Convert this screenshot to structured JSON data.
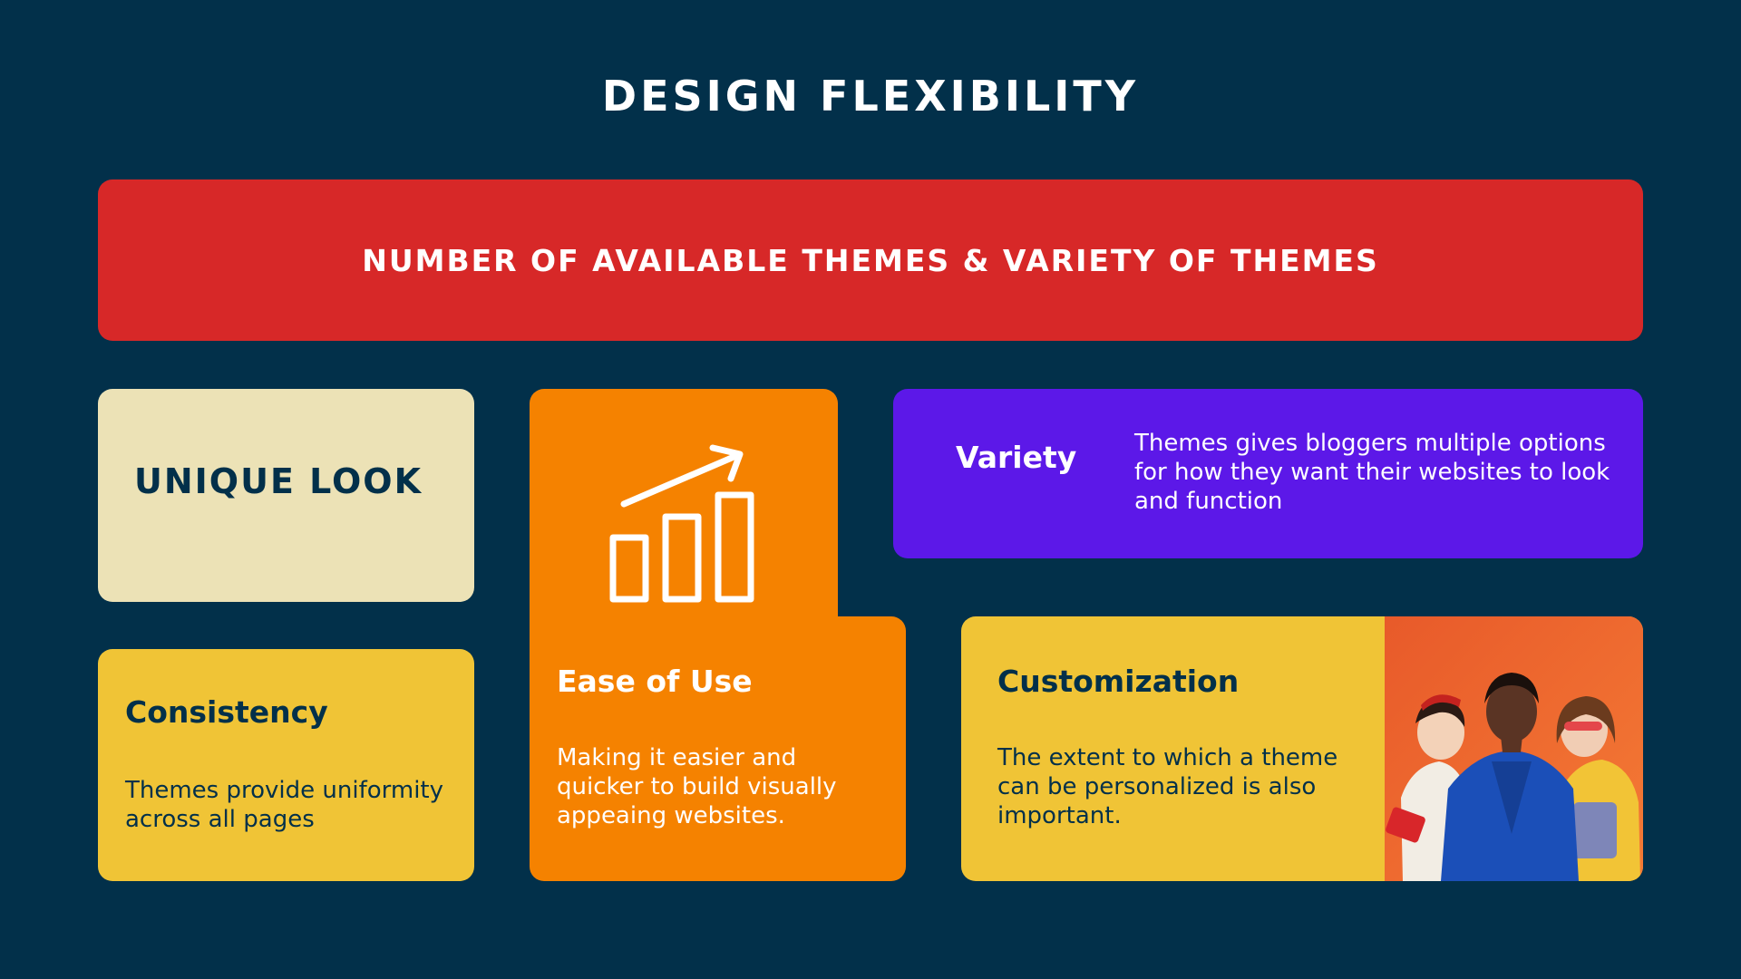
{
  "title": "DESIGN FLEXIBILITY",
  "banner": {
    "text": "NUMBER OF AVAILABLE THEMES & VARIETY OF THEMES"
  },
  "cards": {
    "unique_look": {
      "heading": "UNIQUE LOOK"
    },
    "consistency": {
      "heading": "Consistency",
      "body": "Themes provide uniformity across all pages"
    },
    "ease_of_use": {
      "heading": "Ease of Use",
      "body": "Making it easier and quicker to build visually appeaing websites.",
      "icon": "growth-chart-icon"
    },
    "variety": {
      "heading": "Variety",
      "body": "Themes gives bloggers multiple options for how they want their websites to look and function"
    },
    "customization": {
      "heading": "Customization",
      "body": "The extent to which a theme can be personalized is also important.",
      "image": "three-women-photo"
    }
  },
  "colors": {
    "background": "#02304a",
    "banner": "#d72828",
    "unique_look": "#ece2b6",
    "yellow": "#f0c436",
    "orange": "#f58200",
    "purple": "#5c18e8",
    "text_dark": "#02304a",
    "text_light": "#ffffff"
  }
}
